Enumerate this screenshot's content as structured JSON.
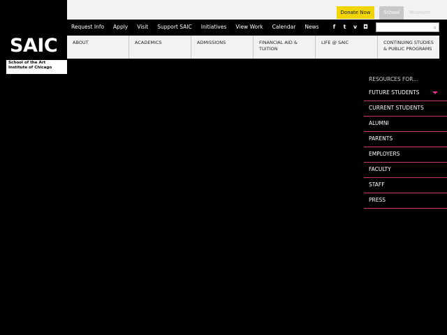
{
  "top": {
    "donate_label": "Donate Now",
    "school_tab": "School",
    "museum_tab": "Museum"
  },
  "logo": {
    "wordmark": "SAIC",
    "subtitle": "School of the Art Institute of Chicago"
  },
  "utility_nav": [
    "Request Info",
    "Apply",
    "Visit",
    "Support SAIC",
    "Initiatives",
    "View Work",
    "Calendar",
    "News"
  ],
  "social_icons": [
    "facebook-icon",
    "twitter-icon",
    "vimeo-icon",
    "instagram-icon"
  ],
  "social_glyphs": [
    "f",
    "t",
    "v",
    "◘"
  ],
  "search": {
    "placeholder": ""
  },
  "main_nav": [
    {
      "label": "ABOUT"
    },
    {
      "label": "ACADEMICS"
    },
    {
      "label": "ADMISSIONS"
    },
    {
      "label": "FINANCIAL AID & TUITION"
    },
    {
      "label": "LIFE @ SAIC"
    },
    {
      "label": "CONTINUING STUDIES & PUBLIC PROGRAMS"
    }
  ],
  "resources": {
    "title": "RESOURCES FOR...",
    "items": [
      "FUTURE STUDENTS",
      "CURRENT STUDENTS",
      "ALUMNI",
      "PARENTS",
      "EMPLOYERS",
      "FACULTY",
      "STAFF",
      "PRESS"
    ]
  },
  "colors": {
    "accent": "#c73a78",
    "donate": "#f1d500",
    "background": "#000000"
  }
}
